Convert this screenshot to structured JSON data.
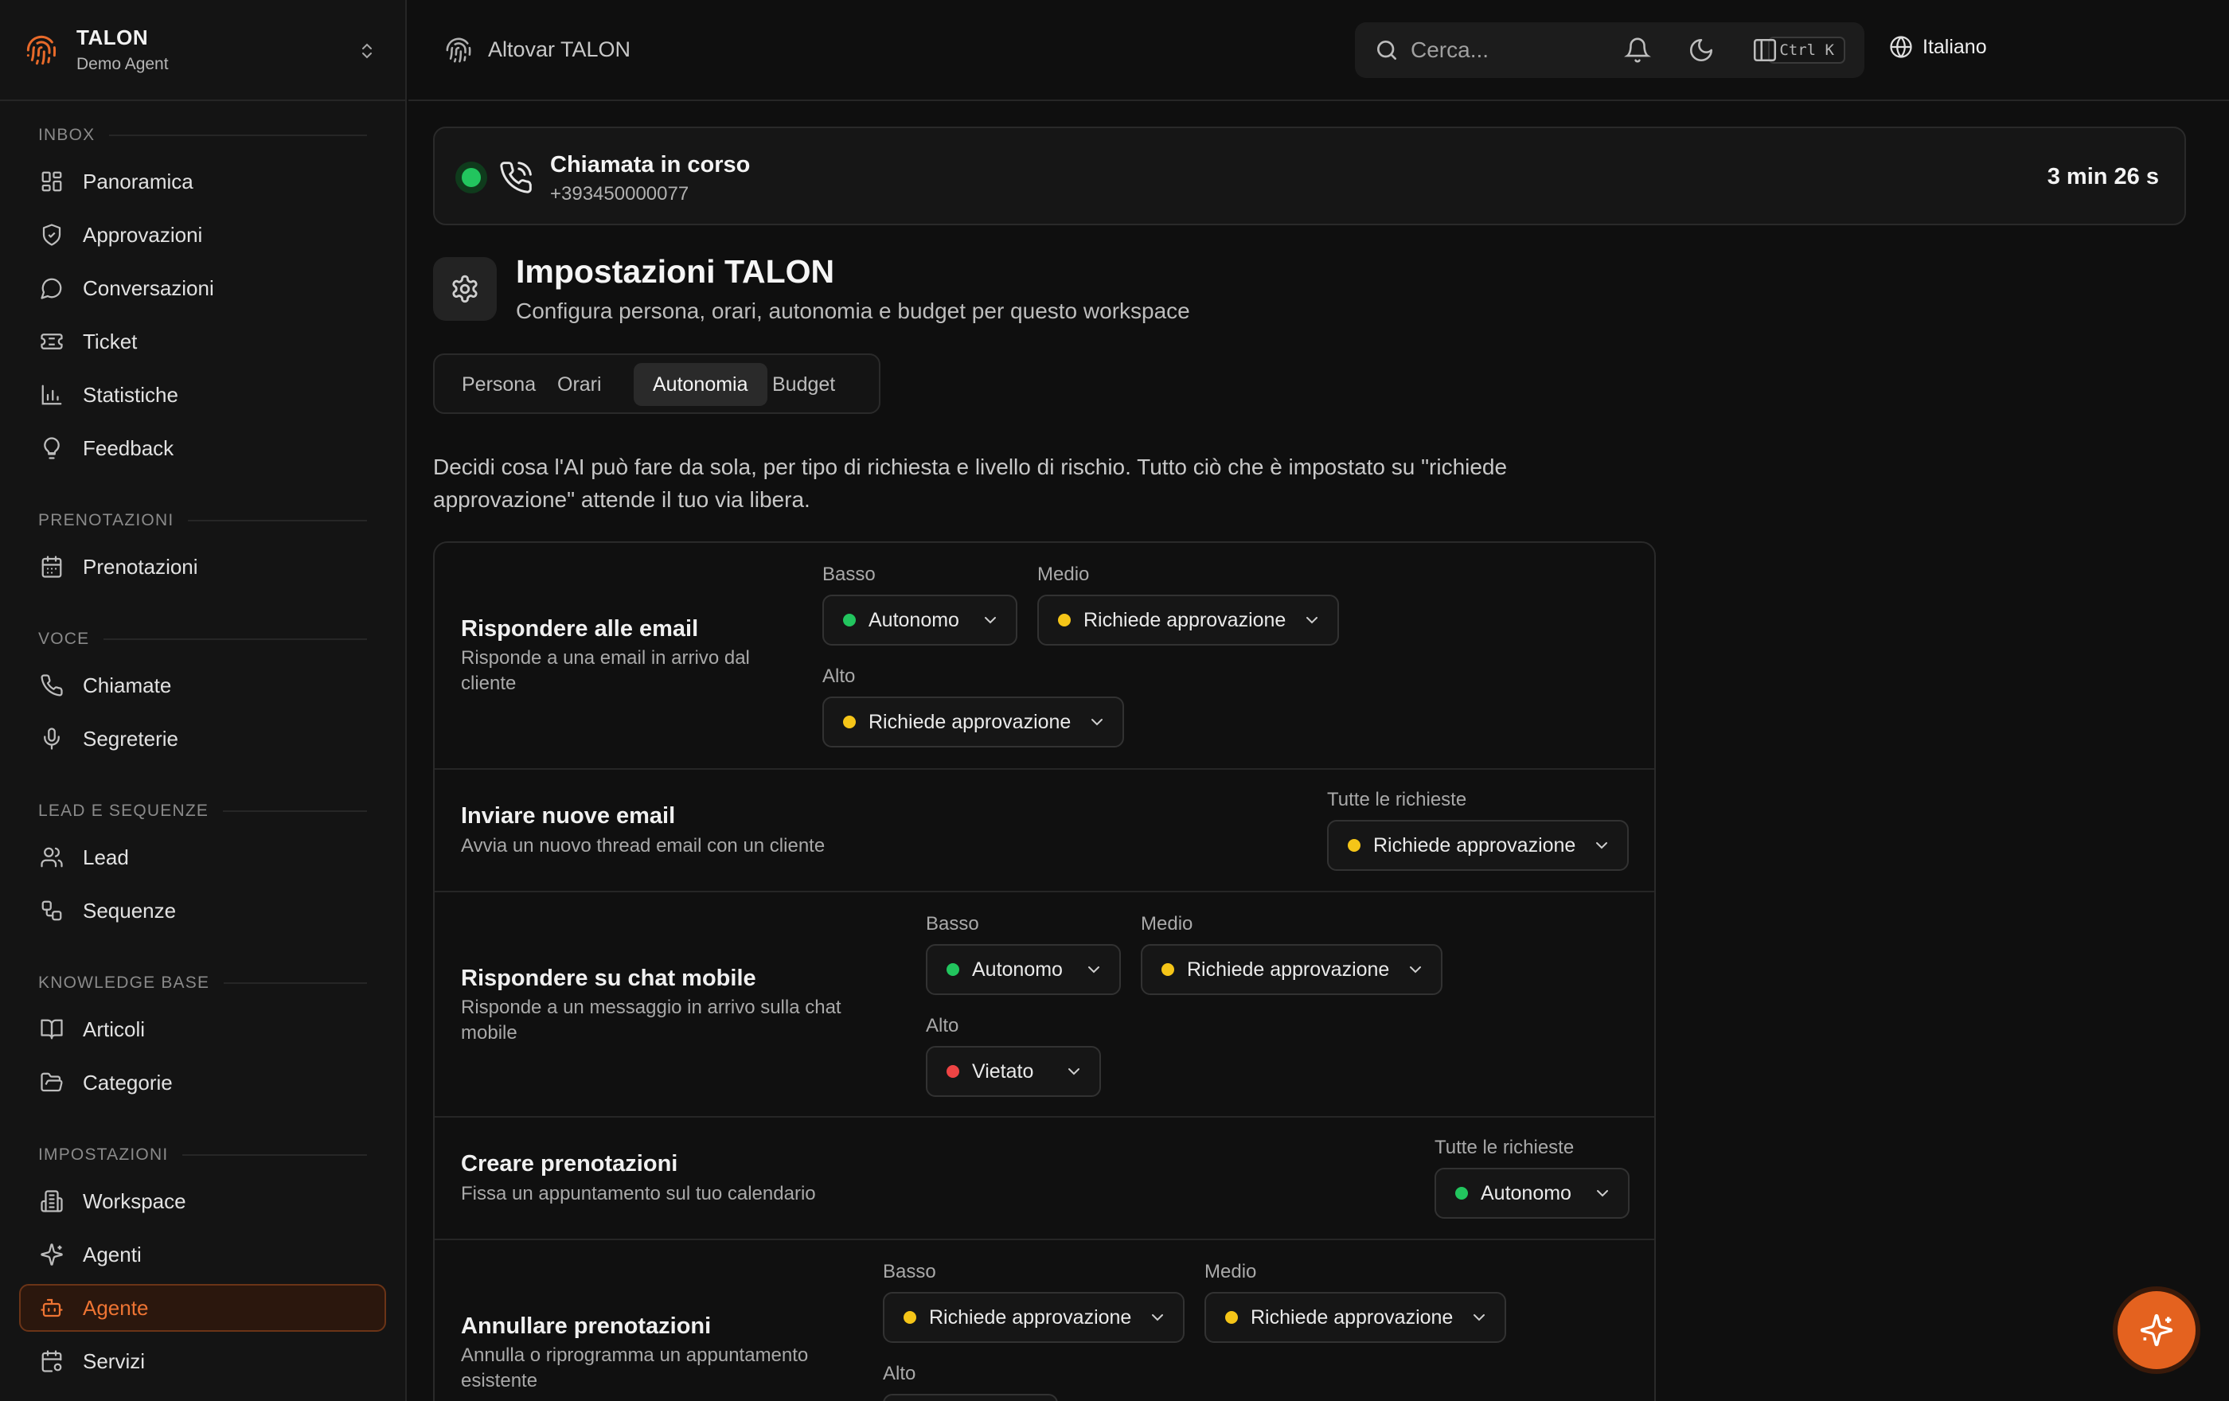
{
  "brand": {
    "name": "TALON",
    "subtitle": "Demo Agent"
  },
  "sidebar": {
    "sections": [
      {
        "title": "INBOX",
        "items": [
          {
            "label": "Panoramica",
            "icon": "dashboard-icon"
          },
          {
            "label": "Approvazioni",
            "icon": "shield-icon"
          },
          {
            "label": "Conversazioni",
            "icon": "chat-icon"
          },
          {
            "label": "Ticket",
            "icon": "ticket-icon"
          },
          {
            "label": "Statistiche",
            "icon": "bar-chart-icon"
          },
          {
            "label": "Feedback",
            "icon": "lightbulb-icon"
          }
        ]
      },
      {
        "title": "PRENOTAZIONI",
        "items": [
          {
            "label": "Prenotazioni",
            "icon": "calendar-icon"
          }
        ]
      },
      {
        "title": "VOCE",
        "items": [
          {
            "label": "Chiamate",
            "icon": "phone-icon"
          },
          {
            "label": "Segreterie",
            "icon": "microphone-icon"
          }
        ]
      },
      {
        "title": "LEAD E SEQUENZE",
        "items": [
          {
            "label": "Lead",
            "icon": "users-icon"
          },
          {
            "label": "Sequenze",
            "icon": "workflow-icon"
          }
        ]
      },
      {
        "title": "KNOWLEDGE BASE",
        "items": [
          {
            "label": "Articoli",
            "icon": "book-icon"
          },
          {
            "label": "Categorie",
            "icon": "folder-icon"
          }
        ]
      },
      {
        "title": "IMPOSTAZIONI",
        "items": [
          {
            "label": "Workspace",
            "icon": "building-icon"
          },
          {
            "label": "Agenti",
            "icon": "sparkles-icon"
          },
          {
            "label": "Agente",
            "icon": "bot-icon",
            "active": true
          },
          {
            "label": "Servizi",
            "icon": "calendar-settings-icon"
          }
        ]
      }
    ]
  },
  "topbar": {
    "breadcrumb": "Altovar TALON",
    "search_placeholder": "Cerca...",
    "search_shortcut": "Ctrl K",
    "language": "Italiano"
  },
  "call": {
    "title": "Chiamata in corso",
    "number": "+393450000077",
    "duration": "3 min 26 s",
    "status_color": "#22c55e"
  },
  "page": {
    "title": "Impostazioni TALON",
    "subtitle": "Configura persona, orari, autonomia e budget per questo workspace",
    "tabs": [
      "Persona",
      "Orari",
      "Autonomia",
      "Budget"
    ],
    "active_tab": "Autonomia",
    "description": "Decidi cosa l'AI può fare da sola, per tipo di richiesta e livello di rischio. Tutto ciò che è impostato su \"richiede approvazione\" attende il tuo via libera."
  },
  "levels": {
    "low": "Basso",
    "medium": "Medio",
    "high": "Alto",
    "all": "Tutte le richieste"
  },
  "status_colors": {
    "Autonomo": "#22c55e",
    "Richiede approvazione": "#f5c518",
    "Vietato": "#ef4444"
  },
  "rules": [
    {
      "title": "Rispondere alle email",
      "description": "Risponde a una email in arrivo dal cliente",
      "low": "Autonomo",
      "medium": "Richiede approvazione",
      "high": "Richiede approvazione"
    },
    {
      "title": "Inviare nuove email",
      "description": "Avvia un nuovo thread email con un cliente",
      "all": "Richiede approvazione"
    },
    {
      "title": "Rispondere su chat mobile",
      "description": "Risponde a un messaggio in arrivo sulla chat mobile",
      "low": "Autonomo",
      "medium": "Richiede approvazione",
      "high": "Vietato"
    },
    {
      "title": "Creare prenotazioni",
      "description": "Fissa un appuntamento sul tuo calendario",
      "all": "Autonomo"
    },
    {
      "title": "Annullare prenotazioni",
      "description": "Annulla o riprogramma un appuntamento esistente",
      "low": "Richiede approvazione",
      "medium": "Richiede approvazione"
    }
  ],
  "colors": {
    "accent": "#e4621f",
    "background": "#0f0f0f",
    "surface": "#161616"
  }
}
